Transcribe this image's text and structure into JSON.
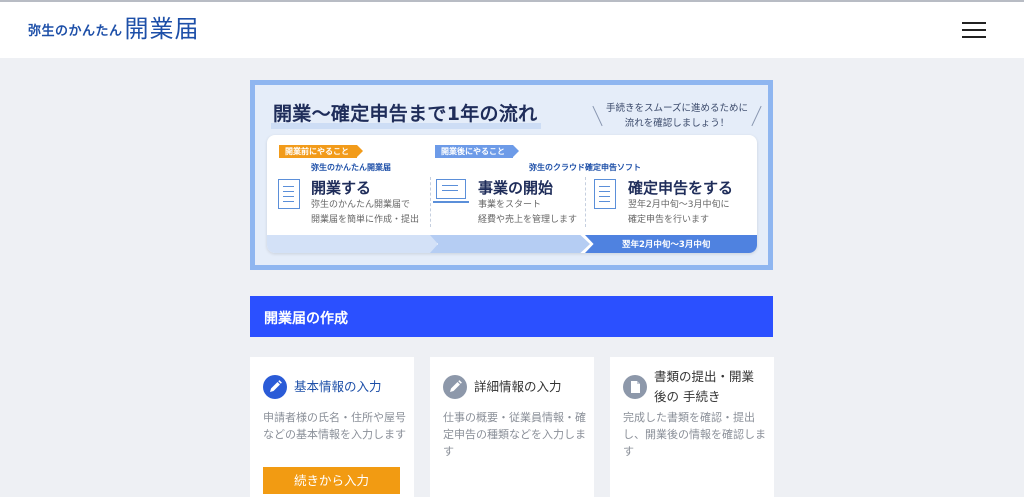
{
  "header": {
    "logo_small": "弥生のかんたん",
    "logo_large": "開業届"
  },
  "flow": {
    "title": "開業〜確定申告まで1年の流れ",
    "note_line1": "手続きをスムーズに進めるために",
    "note_line2": "流れを確認しましょう！",
    "tag_before": "開業前にやること",
    "tag_after": "開業後にやること",
    "sub_before": "弥生のかんたん開業届",
    "sub_after": "弥生のクラウド確定申告ソフト",
    "steps": [
      {
        "title": "開業する",
        "desc1": "弥生のかんたん開業届で",
        "desc2": "開業届を簡単に作成・提出"
      },
      {
        "title": "事業の開始",
        "desc1": "事業をスタート",
        "desc2": "経費や売上を管理します"
      },
      {
        "title": "確定申告をする",
        "desc1": "翌年2月中旬〜3月中旬に",
        "desc2": "確定申告を行います"
      }
    ],
    "period": "翌年2月中旬〜3月中旬"
  },
  "section": {
    "title": "開業届の作成"
  },
  "cards": [
    {
      "title": "基本情報の入力",
      "desc": "申請者様の氏名・住所や屋号などの基本情報を入力します",
      "button": "続きから入力",
      "icon": "pencil-icon"
    },
    {
      "title": "詳細情報の入力",
      "desc": "仕事の概要・従業員情報・確定申告の種類などを入力します",
      "icon": "pencil-icon"
    },
    {
      "title_line1": "書類の提出・開業",
      "title_line2": "後の 手続き",
      "desc": "完成した書類を確認・提出し、開業後の情報を確認します",
      "icon": "document-icon"
    }
  ],
  "colors": {
    "brand": "#1d4fa8",
    "section_bar": "#2b50ff",
    "button_orange": "#f29b12",
    "icon_active": "#2a5bd7",
    "icon_inactive": "#8d98aa"
  }
}
